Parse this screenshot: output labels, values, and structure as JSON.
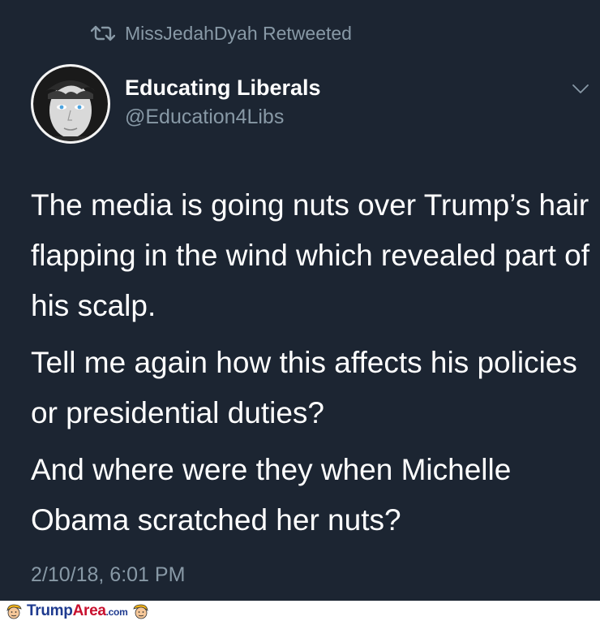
{
  "retweet": {
    "label": "MissJedahDyah Retweeted",
    "icon": "retweet-icon"
  },
  "author": {
    "name": "Educating Liberals",
    "handle": "@Education4Libs",
    "avatar": "avatar"
  },
  "tweet": {
    "paragraphs": [
      "The media is going nuts over Trump’s hair flapping in the wind which revealed part of his scalp.",
      "Tell me again how this affects his policies or presidential duties?",
      "And where were they when Michelle Obama scratched her nuts?"
    ],
    "timestamp": "2/10/18, 6:01 PM"
  },
  "watermark": {
    "brand_part1": "Trump",
    "brand_part2": "Area",
    "brand_part3": ".com"
  },
  "colors": {
    "background": "#1c2532",
    "muted": "#8899a6",
    "text": "#ffffff",
    "brand_blue": "#1e3a8f",
    "brand_red": "#c8102e"
  }
}
